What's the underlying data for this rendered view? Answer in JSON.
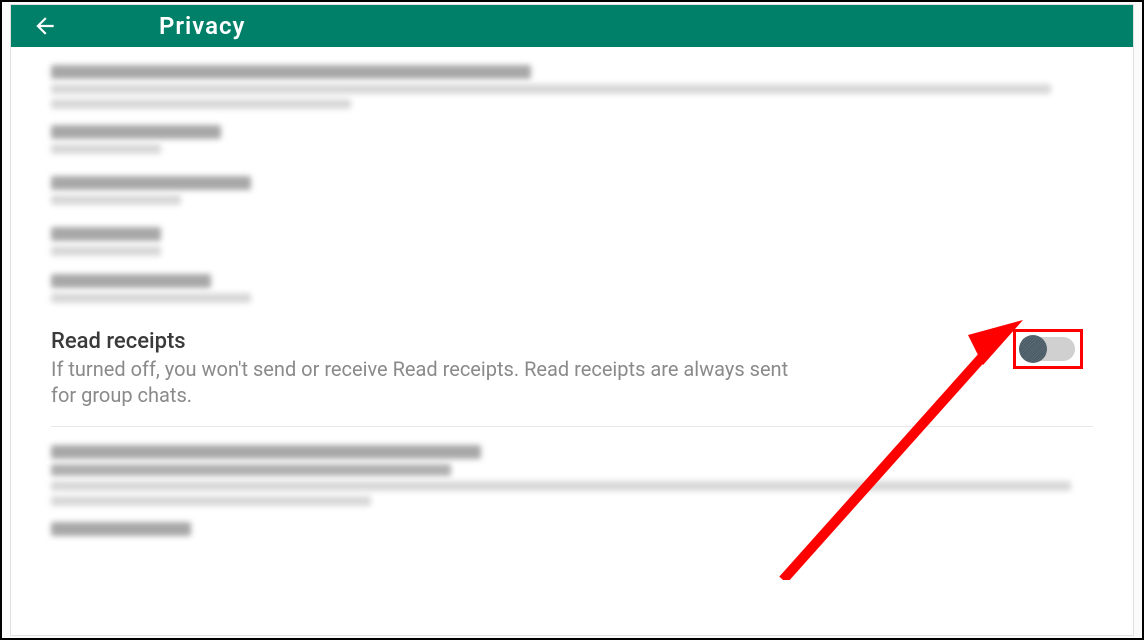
{
  "header": {
    "title": "Privacy"
  },
  "settings": {
    "read_receipts": {
      "title": "Read receipts",
      "description": "If turned off, you won't send or receive Read receipts. Read receipts are always sent for group chats.",
      "enabled": false
    }
  },
  "annotation": {
    "highlight_color": "#ff0000"
  }
}
